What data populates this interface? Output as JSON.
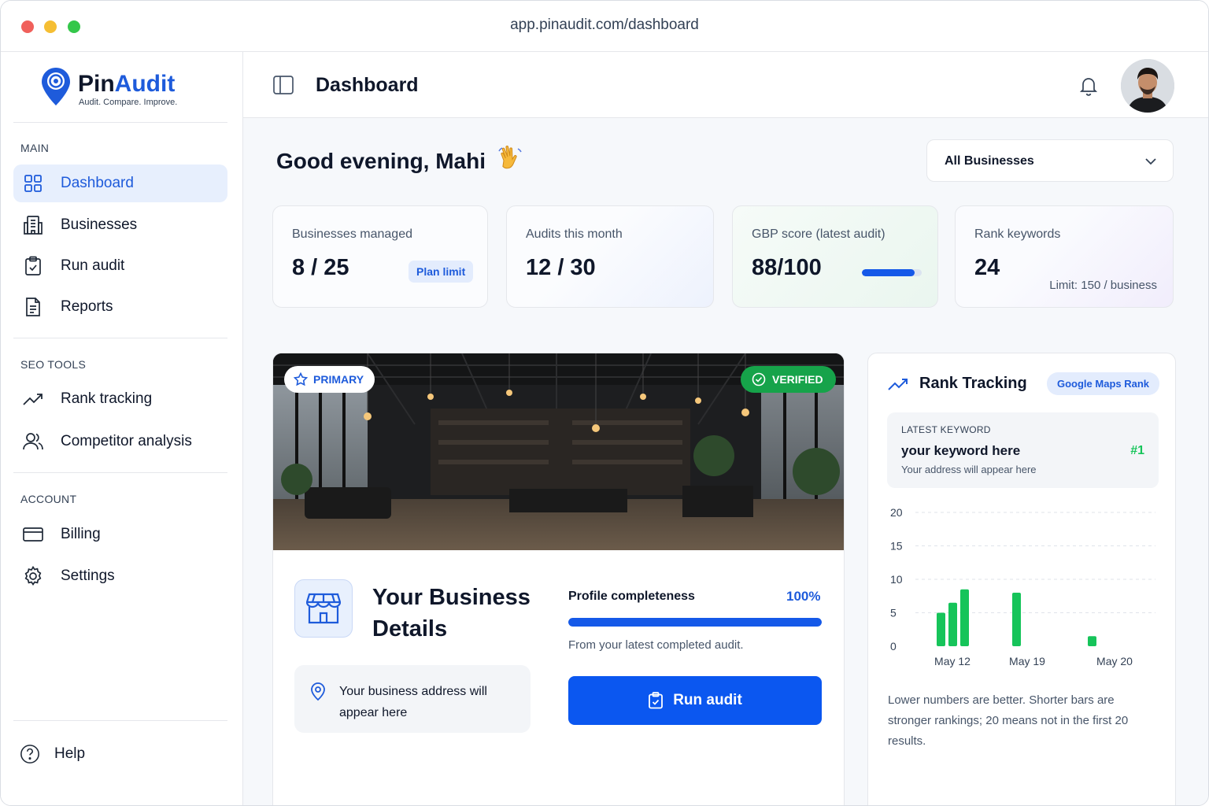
{
  "browser": {
    "url": "app.pinaudit.com/dashboard"
  },
  "brand": {
    "name_part1": "Pin",
    "name_part2": "Audit",
    "tagline": "Audit. Compare. Improve.",
    "accent": "#1e5bdb"
  },
  "sidebar": {
    "sections": {
      "main": "MAIN",
      "seo": "SEO TOOLS",
      "account": "ACCOUNT"
    },
    "items": [
      {
        "label": "Dashboard",
        "icon": "grid-icon",
        "active": true
      },
      {
        "label": "Businesses",
        "icon": "building-icon"
      },
      {
        "label": "Run audit",
        "icon": "clipboard-check-icon"
      },
      {
        "label": "Reports",
        "icon": "document-icon"
      },
      {
        "label": "Rank tracking",
        "icon": "trend-up-icon"
      },
      {
        "label": "Competitor analysis",
        "icon": "users-icon"
      },
      {
        "label": "Billing",
        "icon": "card-icon"
      },
      {
        "label": "Settings",
        "icon": "gear-icon"
      }
    ],
    "help": "Help"
  },
  "header": {
    "title": "Dashboard"
  },
  "main": {
    "greeting": "Good evening, Mahi",
    "business_select": "All Businesses",
    "stats": [
      {
        "label": "Businesses managed",
        "value": "8 / 25",
        "badge": "Plan limit"
      },
      {
        "label": "Audits this month",
        "value": "12 / 30"
      },
      {
        "label": "GBP score (latest audit)",
        "value": "88/100",
        "score_fraction": 0.88
      },
      {
        "label": "Rank keywords",
        "value": "24",
        "note": "Limit: 150 / business"
      }
    ]
  },
  "business": {
    "primary": "PRIMARY",
    "verified": "VERIFIED",
    "title": "Your Business Details",
    "address": "Your business address will appear here",
    "completeness_label": "Profile completeness",
    "completeness_value": "100%",
    "completeness_fraction": 1.0,
    "completeness_note": "From your latest completed audit.",
    "run_button": "Run audit"
  },
  "rank": {
    "title": "Rank Tracking",
    "badge": "Google Maps Rank",
    "keyword_caption": "LATEST KEYWORD",
    "keyword": "your keyword here",
    "keyword_rank": "#1",
    "keyword_address": "Your address will appear here",
    "note": "Lower numbers are better. Shorter bars are stronger rankings; 20 means not in the first 20 results."
  },
  "chart_data": {
    "type": "bar",
    "ylim": [
      0,
      20
    ],
    "yticks": [
      0,
      5,
      10,
      15,
      20
    ],
    "x_tick_labels": [
      "May 12",
      "May 19",
      "May 20"
    ],
    "bar_color": "#16c45a",
    "bars": [
      {
        "day": "May 10",
        "value": 5
      },
      {
        "day": "May 11",
        "value": 6.5
      },
      {
        "day": "May 12",
        "value": 8.5
      },
      {
        "day": "May 19",
        "value": 8
      },
      {
        "day": "May 20",
        "value": 1.5
      }
    ],
    "grid": true
  }
}
